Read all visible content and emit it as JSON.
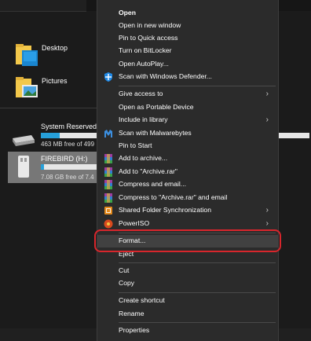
{
  "quick_access": [
    {
      "label": "Desktop"
    },
    {
      "label": "Pictures"
    }
  ],
  "drives": [
    {
      "name": "System Reserved (",
      "free": "463 MB free of 499",
      "used_fraction": 0.07
    },
    {
      "name": "FIREBIRD (H:)",
      "free": "7.08 GB free of 7.4",
      "used_fraction": 0.05
    }
  ],
  "context_menu": {
    "items": [
      {
        "label": "Open",
        "bold": true,
        "icon": "",
        "arrow": false
      },
      {
        "label": "Open in new window",
        "icon": "",
        "arrow": false
      },
      {
        "label": "Pin to Quick access",
        "icon": "",
        "arrow": false
      },
      {
        "label": "Turn on BitLocker",
        "icon": "",
        "arrow": false
      },
      {
        "label": "Open AutoPlay...",
        "icon": "",
        "arrow": false
      },
      {
        "label": "Scan with Windows Defender...",
        "icon": "defender-icon",
        "arrow": false
      },
      {
        "label": "Give access to",
        "icon": "",
        "arrow": true
      },
      {
        "label": "Open as Portable Device",
        "icon": "",
        "arrow": false
      },
      {
        "label": "Include in library",
        "icon": "",
        "arrow": true
      },
      {
        "label": "Scan with Malwarebytes",
        "icon": "malwarebytes-icon",
        "arrow": false
      },
      {
        "label": "Pin to Start",
        "icon": "",
        "arrow": false
      },
      {
        "label": "Add to archive...",
        "icon": "winrar-icon",
        "arrow": false
      },
      {
        "label": "Add to \"Archive.rar\"",
        "icon": "winrar-icon",
        "arrow": false
      },
      {
        "label": "Compress and email...",
        "icon": "winrar-icon",
        "arrow": false
      },
      {
        "label": "Compress to \"Archive.rar\" and email",
        "icon": "winrar-icon",
        "arrow": false
      },
      {
        "label": "Shared Folder Synchronization",
        "icon": "sync-icon",
        "arrow": true
      },
      {
        "label": "PowerISO",
        "icon": "poweriso-icon",
        "arrow": true
      },
      {
        "label": "Format...",
        "icon": "",
        "arrow": false
      },
      {
        "label": "Eject",
        "icon": "",
        "arrow": false
      },
      {
        "label": "Cut",
        "icon": "",
        "arrow": false
      },
      {
        "label": "Copy",
        "icon": "",
        "arrow": false
      },
      {
        "label": "Create shortcut",
        "icon": "",
        "arrow": false
      },
      {
        "label": "Rename",
        "icon": "",
        "arrow": false
      },
      {
        "label": "Properties",
        "icon": "",
        "arrow": false
      }
    ]
  },
  "colors": {
    "highlight_ring": "#d8262c",
    "progress_fill": "#26a0da"
  }
}
